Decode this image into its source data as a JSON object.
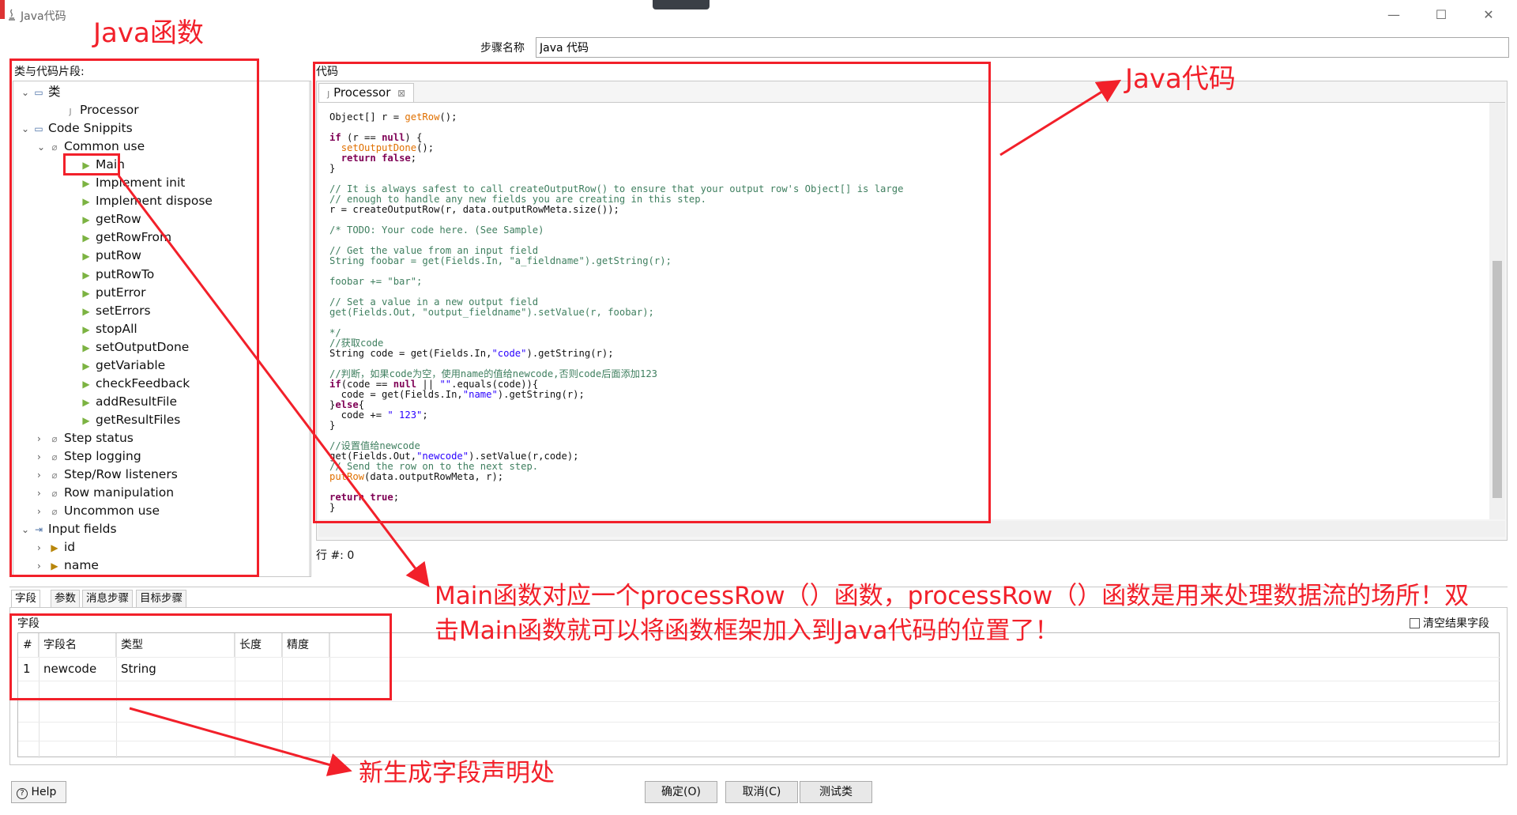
{
  "window": {
    "title": "Java代码",
    "minimize_glyph": "—",
    "maximize_glyph": "☐",
    "close_glyph": "✕"
  },
  "step_name": {
    "label": "步骤名称",
    "value": "Java 代码"
  },
  "left_panel": {
    "label": "类与代码片段:",
    "tree": [
      {
        "label": "类",
        "icon": "folder-icon"
      },
      {
        "label": "Processor",
        "icon": "java-class-icon"
      },
      {
        "label": "Code Snippits",
        "icon": "folder-icon"
      },
      {
        "label": "Common use",
        "icon": "pin-icon"
      },
      {
        "label": "Main",
        "icon": "snippet-icon"
      },
      {
        "label": "Implement init",
        "icon": "snippet-icon"
      },
      {
        "label": "Implement dispose",
        "icon": "snippet-icon"
      },
      {
        "label": "getRow",
        "icon": "snippet-icon"
      },
      {
        "label": "getRowFrom",
        "icon": "snippet-icon"
      },
      {
        "label": "putRow",
        "icon": "snippet-icon"
      },
      {
        "label": "putRowTo",
        "icon": "snippet-icon"
      },
      {
        "label": "putError",
        "icon": "snippet-icon"
      },
      {
        "label": "setErrors",
        "icon": "snippet-icon"
      },
      {
        "label": "stopAll",
        "icon": "snippet-icon"
      },
      {
        "label": "setOutputDone",
        "icon": "snippet-icon"
      },
      {
        "label": "getVariable",
        "icon": "snippet-icon"
      },
      {
        "label": "checkFeedback",
        "icon": "snippet-icon"
      },
      {
        "label": "addResultFile",
        "icon": "snippet-icon"
      },
      {
        "label": "getResultFiles",
        "icon": "snippet-icon"
      },
      {
        "label": "Step status",
        "icon": "pin-icon"
      },
      {
        "label": "Step logging",
        "icon": "pin-icon"
      },
      {
        "label": "Step/Row listeners",
        "icon": "pin-icon"
      },
      {
        "label": "Row manipulation",
        "icon": "pin-icon"
      },
      {
        "label": "Uncommon use",
        "icon": "pin-icon"
      },
      {
        "label": "Input fields",
        "icon": "input-fields-icon"
      },
      {
        "label": "id",
        "icon": "field-icon"
      },
      {
        "label": "name",
        "icon": "field-icon"
      }
    ]
  },
  "code_panel": {
    "label": "代码",
    "tab_label": "Processor",
    "tab_close": "⊠",
    "row_info": "行 #: 0",
    "lines": [
      "Object[] r = getRow();",
      "",
      "if (r == null) {",
      "  setOutputDone();",
      "  return false;",
      "}",
      "",
      "// It is always safest to call createOutputRow() to ensure that your output row's Object[] is large",
      "// enough to handle any new fields you are creating in this step.",
      "r = createOutputRow(r, data.outputRowMeta.size());",
      "",
      "/* TODO: Your code here. (See Sample)",
      "",
      "// Get the value from an input field",
      "String foobar = get(Fields.In, \"a_fieldname\").getString(r);",
      "",
      "foobar += \"bar\";",
      "",
      "// Set a value in a new output field",
      "get(Fields.Out, \"output_fieldname\").setValue(r, foobar);",
      "",
      "*/",
      "//获取code",
      "String code = get(Fields.In,\"code\").getString(r);",
      "",
      "//判断，如果code为空，使用name的值给newcode,否则code后面添加123",
      "if(code == null || \"\".equals(code)){",
      "  code = get(Fields.In,\"name\").getString(r);",
      "}else{",
      "  code += \" 123\";",
      "}",
      "",
      "//设置值给newcode",
      "get(Fields.Out,\"newcode\").setValue(r,code);",
      "// Send the row on to the next step.",
      "putRow(data.outputRowMeta, r);",
      "",
      "return true;",
      "}"
    ]
  },
  "bottom_tabs": [
    "字段",
    "参数",
    "消息步骤",
    "目标步骤"
  ],
  "fields": {
    "label": "字段",
    "clear_checkbox_label": "清空结果字段",
    "columns": [
      "#",
      "字段名",
      "类型",
      "长度",
      "精度"
    ],
    "rows": [
      [
        "1",
        "newcode",
        "String",
        "",
        ""
      ]
    ]
  },
  "buttons": {
    "help": "Help",
    "ok": "确定(O)",
    "cancel": "取消(C)",
    "test_class": "测试类"
  },
  "annotations": {
    "java_functions": "Java函数",
    "java_code": "Java代码",
    "main_line1": "Main函数对应一个processRow（）函数，processRow（）函数是用来处理数据流的场所！双",
    "main_line2": "击Main函数就可以将函数框架加入到Java代码的位置了！",
    "new_field": "新生成字段声明处",
    "color": "#f2202a"
  }
}
